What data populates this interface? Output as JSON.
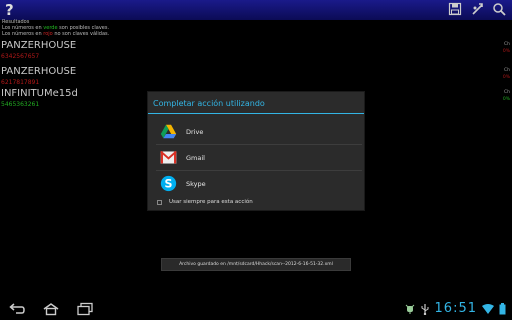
{
  "actionbar": {
    "help_label": "?",
    "icons": [
      "save-icon",
      "settings-icon",
      "search-icon"
    ]
  },
  "legend": {
    "title": "Resultados",
    "line1_prefix": "Los números en",
    "line1_word": "verde",
    "line1_suffix": "son posibles claves.",
    "line2_prefix": "Los números en",
    "line2_word": "rojo",
    "line2_suffix": "no son claves válidas."
  },
  "networks": [
    {
      "name": "PANZERHOUSE",
      "key": "6342567657",
      "key_status": "red",
      "channel": "Ch",
      "percent": "0%",
      "percent_status": "red"
    },
    {
      "name": "PANZERHOUSE",
      "key": "6217817891",
      "key_status": "red",
      "channel": "Ch",
      "percent": "0%",
      "percent_status": "red"
    },
    {
      "name": "INFINITUMe15d",
      "key": "5465363261",
      "key_status": "green",
      "channel": "Ch",
      "percent": "0%",
      "percent_status": "green"
    }
  ],
  "dialog": {
    "title": "Completar acción utilizando",
    "options": [
      {
        "label": "Drive",
        "icon": "drive-icon"
      },
      {
        "label": "Gmail",
        "icon": "gmail-icon"
      },
      {
        "label": "Skype",
        "icon": "skype-icon"
      }
    ],
    "always_use_label": "Usar siempre para esta acción",
    "always_use_checked": false
  },
  "toast": {
    "text": "Archivo guardado en /mnt/sdcard/Hhack/scan--2012-6-16-51-32.xml"
  },
  "navbar": {
    "buttons": [
      "back-icon",
      "home-icon",
      "recent-apps-icon"
    ]
  },
  "status": {
    "time": "16:51",
    "icons": [
      "usb-debug-icon",
      "usb-icon",
      "wifi-icon",
      "battery-icon"
    ]
  },
  "colors": {
    "accent": "#33b5e5",
    "actionbar": "#1a1a8a",
    "key_red": "#b01818",
    "key_green": "#22aa22"
  }
}
